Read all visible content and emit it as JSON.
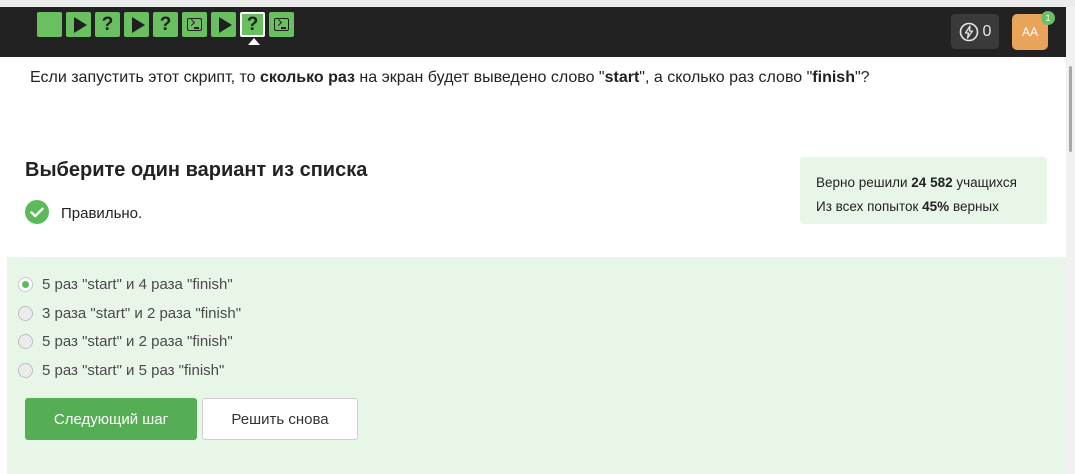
{
  "steps": [
    {
      "type": "blank"
    },
    {
      "type": "play"
    },
    {
      "type": "quiz",
      "label": "?"
    },
    {
      "type": "play"
    },
    {
      "type": "quiz",
      "label": "?"
    },
    {
      "type": "code"
    },
    {
      "type": "play"
    },
    {
      "type": "quiz",
      "label": "?",
      "current": true
    },
    {
      "type": "code"
    }
  ],
  "header": {
    "energy_count": "0",
    "avatar_initials": "AA",
    "notification_count": "1"
  },
  "question": {
    "part1": "Если запустить этот скрипт, то ",
    "bold1": "сколько раз",
    "part2": " на экран будет выведено слово \"",
    "bold2": "start",
    "part3": "\", а сколько раз слово \"",
    "bold3": "finish",
    "part4": "\"?"
  },
  "task": {
    "heading": "Выберите один вариант из списка",
    "status_text": "Правильно."
  },
  "stats": {
    "line1_prefix": "Верно решили ",
    "line1_value": "24 582",
    "line1_suffix": " учащихся",
    "line2_prefix": "Из всех попыток ",
    "line2_value": "45%",
    "line2_suffix": " верных"
  },
  "options": [
    {
      "label": "5 раз \"start\" и 4 раза \"finish\"",
      "selected": true
    },
    {
      "label": "3 раза \"start\" и 2 раза \"finish\"",
      "selected": false
    },
    {
      "label": "5 раз \"start\" и 2 раза \"finish\"",
      "selected": false
    },
    {
      "label": "5 раз \"start\" и 5 раз \"finish\"",
      "selected": false
    }
  ],
  "buttons": {
    "next": "Следующий шаг",
    "retry": "Решить снова"
  },
  "colors": {
    "accent_green": "#5cba5b",
    "topbar": "#222222",
    "panel_green": "#e8f6e7",
    "avatar": "#e8a45a"
  }
}
